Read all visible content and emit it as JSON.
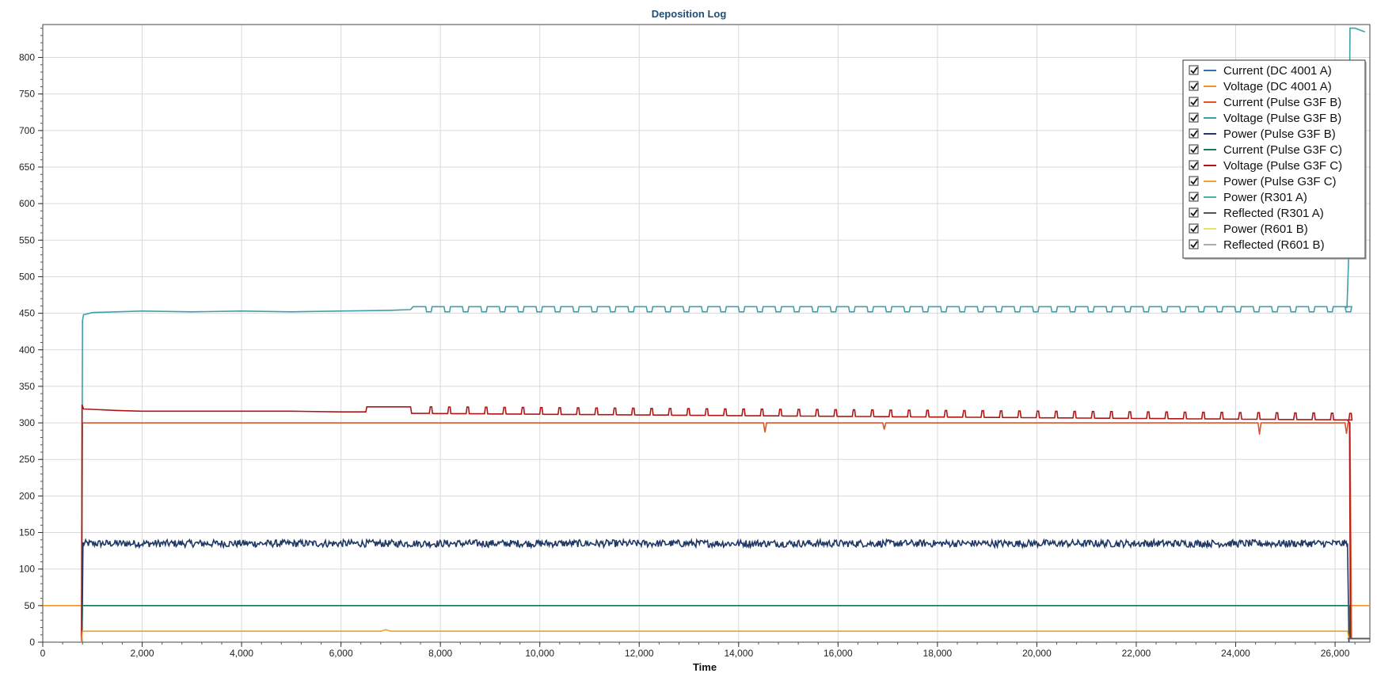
{
  "chart_data": {
    "type": "line",
    "title": "Deposition Log",
    "xlabel": "Time",
    "ylabel": "",
    "xlim": [
      0,
      26700
    ],
    "ylim": [
      0,
      845
    ],
    "x_ticks": [
      0,
      2000,
      4000,
      6000,
      8000,
      10000,
      12000,
      14000,
      16000,
      18000,
      20000,
      22000,
      24000,
      26000
    ],
    "x_tick_labels": [
      "0",
      "2,000",
      "4,000",
      "6,000",
      "8,000",
      "10,000",
      "12,000",
      "14,000",
      "16,000",
      "18,000",
      "20,000",
      "22,000",
      "24,000",
      "26,000"
    ],
    "y_ticks": [
      0,
      50,
      100,
      150,
      200,
      250,
      300,
      350,
      400,
      450,
      500,
      550,
      600,
      650,
      700,
      750,
      800
    ],
    "y_tick_labels": [
      "0",
      "50",
      "100",
      "150",
      "200",
      "250",
      "300",
      "350",
      "400",
      "450",
      "500",
      "550",
      "600",
      "650",
      "700",
      "750",
      "800"
    ],
    "grid": true,
    "legend_position": "top-right",
    "series": [
      {
        "name": "Current (DC 4001 A)",
        "color": "#3a6fa8",
        "checked": true,
        "x": [],
        "y": []
      },
      {
        "name": "Voltage (DC 4001 A)",
        "color": "#e8962a",
        "checked": true,
        "x": [
          0,
          26700
        ],
        "y": [
          50,
          50
        ]
      },
      {
        "name": "Current (Pulse G3F B)",
        "color": "#e0542a",
        "checked": true,
        "x": [
          780,
          800,
          14500,
          14530,
          14560,
          16900,
          16930,
          16960,
          24450,
          24480,
          24510,
          26200,
          26230,
          26260,
          26300,
          26330,
          26700
        ],
        "y": [
          0,
          300,
          300,
          287,
          300,
          300,
          291,
          300,
          300,
          284,
          300,
          300,
          285,
          300,
          300,
          5,
          5
        ]
      },
      {
        "name": "Voltage (Pulse G3F B)",
        "color": "#3fa0aa",
        "checked": true,
        "x": [
          780,
          800,
          820,
          1000,
          2000,
          3000,
          4000,
          5000,
          6000,
          7000,
          7400,
          7450,
          26200,
          26240,
          26270,
          26300,
          26400,
          26600
        ],
        "y": [
          25,
          440,
          448,
          451,
          453,
          452,
          453,
          452,
          453,
          454,
          455,
          459,
          459,
          458,
          520,
          840,
          840,
          835
        ],
        "pattern": {
          "from": 7500,
          "to": 26200,
          "period": 370,
          "dip": 452,
          "base": 459
        }
      },
      {
        "name": "Power (Pulse G3F B)",
        "color": "#1f3864",
        "checked": true,
        "x": [
          790,
          810,
          26250,
          26280
        ],
        "y": [
          0,
          135,
          135,
          0
        ],
        "noise_amplitude": 5
      },
      {
        "name": "Current (Pulse G3F C)",
        "color": "#1a7a5a",
        "checked": true,
        "x": [
          780,
          800,
          26280,
          26300,
          26700
        ],
        "y": [
          0,
          50,
          50,
          5,
          5
        ]
      },
      {
        "name": "Voltage (Pulse G3F C)",
        "color": "#b01515",
        "checked": true,
        "x": [
          780,
          790,
          820,
          1500,
          2000,
          3000,
          4000,
          5000,
          6000,
          6500,
          6520,
          7400,
          7420,
          26250,
          26290,
          26310,
          26700
        ],
        "y": [
          0,
          325,
          319,
          317,
          316,
          316,
          316,
          316,
          315,
          315,
          322,
          322,
          313,
          304,
          300,
          5,
          5
        ],
        "pattern": {
          "from": 7500,
          "to": 26200,
          "period": 370,
          "pulse": 9
        }
      },
      {
        "name": "Power (Pulse G3F C)",
        "color": "#e8a530",
        "checked": true,
        "x": [
          780,
          800,
          6800,
          6900,
          7000,
          26250,
          26280,
          26700
        ],
        "y": [
          0,
          15,
          15,
          17,
          15,
          15,
          5,
          5
        ]
      },
      {
        "name": "Power (R301 A)",
        "color": "#4bb0b0",
        "checked": true,
        "x": [],
        "y": []
      },
      {
        "name": "Reflected (R301 A)",
        "color": "#555555",
        "checked": true,
        "x": [
          26250,
          26700
        ],
        "y": [
          5,
          5
        ]
      },
      {
        "name": "Power (R601 B)",
        "color": "#e3e36a",
        "checked": true,
        "x": [],
        "y": []
      },
      {
        "name": "Reflected (R601 B)",
        "color": "#aaaaaa",
        "checked": true,
        "x": [],
        "y": []
      }
    ]
  }
}
